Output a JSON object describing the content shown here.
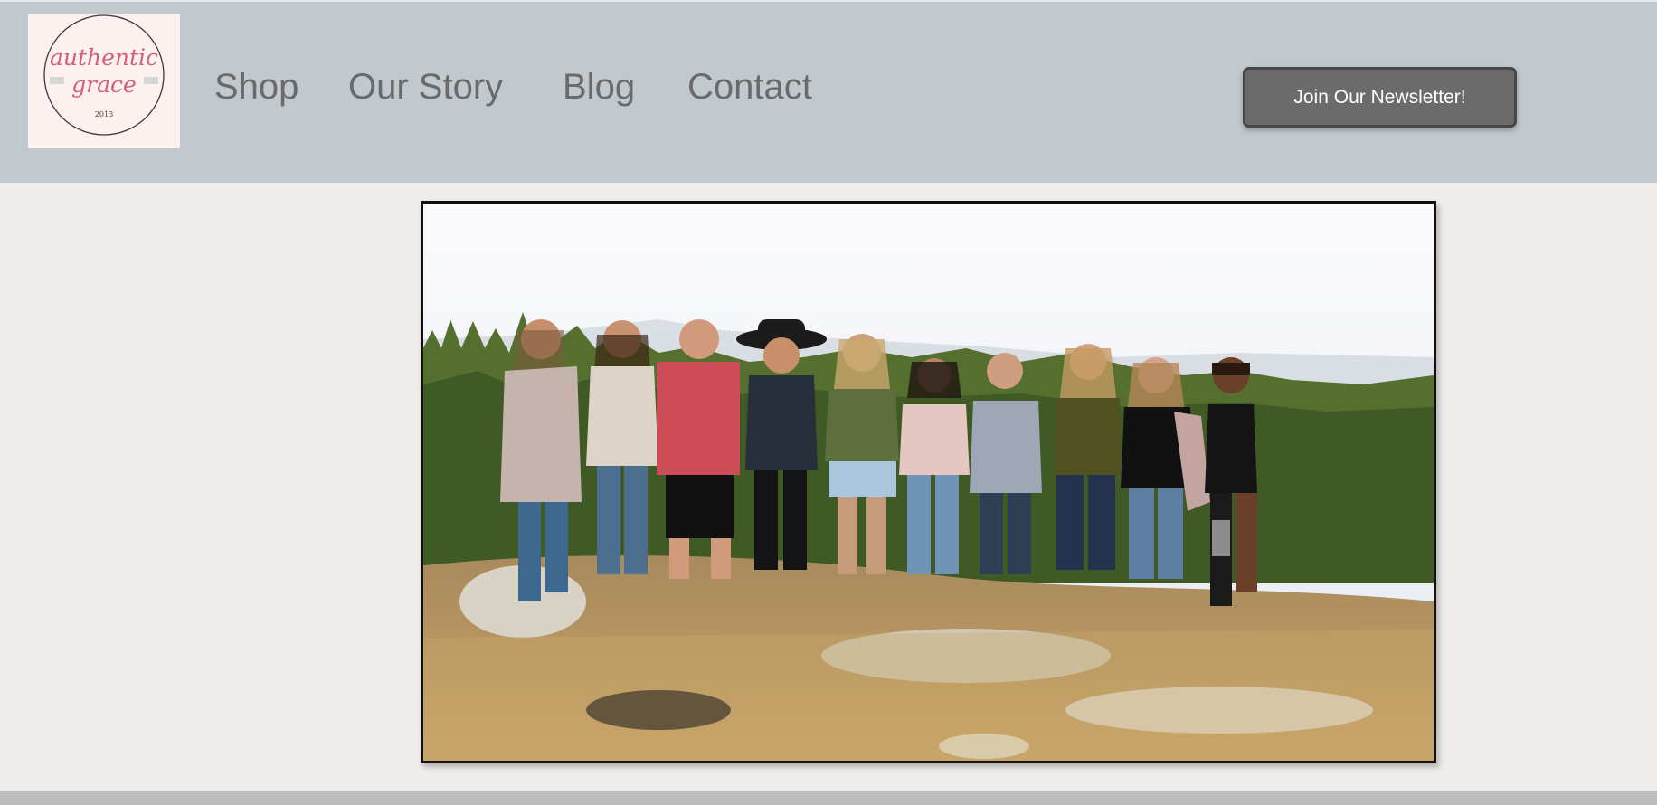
{
  "brand": {
    "logo_line1": "authentic",
    "logo_line2": "grace",
    "logo_year": "2013",
    "logo_color": "#d45f79"
  },
  "nav": {
    "items": [
      {
        "label": "Shop"
      },
      {
        "label": "Our Story"
      },
      {
        "label": "Blog"
      },
      {
        "label": "Contact"
      }
    ]
  },
  "newsletter": {
    "label": "Join Our Newsletter!"
  },
  "hero": {
    "alt": "Group of friends standing together on rocks in front of a forest"
  },
  "colors": {
    "header_bg": "#c1c8ce",
    "page_bg": "#efecea",
    "nav_text": "#6a6a6a",
    "button_bg": "#6b6b6b"
  }
}
